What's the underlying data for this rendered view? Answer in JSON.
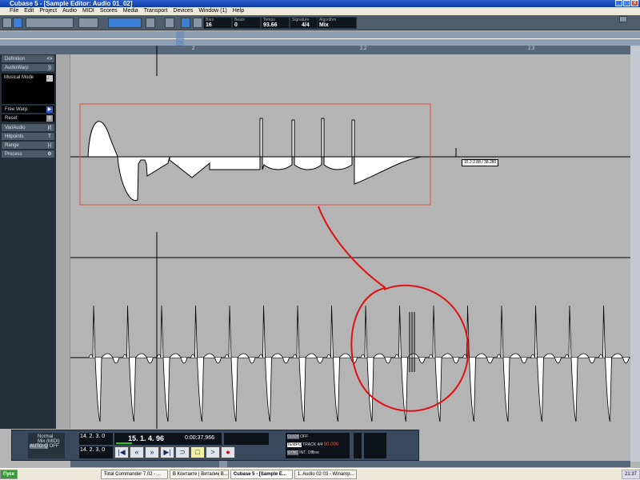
{
  "window": {
    "title": "Cubase 5 - [Sample Editor: Audio 01_02]"
  },
  "menu": [
    "File",
    "Edit",
    "Project",
    "Audio",
    "MIDI",
    "Scores",
    "Media",
    "Transport",
    "Devices",
    "Window (1)",
    "Help"
  ],
  "toolbar": {
    "fields": [
      {
        "label": "Bars",
        "value": "16"
      },
      {
        "label": "Beats",
        "value": "0"
      },
      {
        "label": "Tempo",
        "value": "93.66"
      },
      {
        "label": "Signature",
        "value": "4/4"
      },
      {
        "label": "Algorithm",
        "value": "Mix"
      }
    ]
  },
  "ruler": {
    "marks": [
      "2",
      "2.2",
      "2.3"
    ]
  },
  "sidebar": {
    "sections": [
      {
        "label": "Definition",
        "icon": "<>"
      },
      {
        "label": "AudioWarp",
        "icon": "))"
      },
      {
        "label": "Musical Mode",
        "icon": "♩"
      },
      {
        "label": "Free Warp",
        "icon": "▶"
      },
      {
        "label": "Reset",
        "icon": "≡"
      },
      {
        "label": "VariAudio",
        "icon": "|/|"
      },
      {
        "label": "Hitpoints",
        "icon": "T"
      },
      {
        "label": "Range",
        "icon": "|-|"
      },
      {
        "label": "Process",
        "icon": "⚙"
      }
    ]
  },
  "editor": {
    "tooltip": "15.2.2.88 / 38.280"
  },
  "transport": {
    "mode1": "Normal",
    "mode2": "Mix (MIDI)",
    "auto": "AUTO Q",
    "auto_value": "OFF",
    "left_locator": "14. 2. 3.   0",
    "right_locator": "14. 2. 3.   0",
    "position": "15. 1. 4. 96",
    "time": "0:00:37.966",
    "click": "CLICK",
    "click_value": "OFF",
    "tempo_label": "TEMPO",
    "tempo_mode": "TRACK",
    "signature": "4/4",
    "tempo": "90.000",
    "sync": "SYNC",
    "sync_mode": "INT.",
    "sync_state": "Offline"
  },
  "taskbar": {
    "start": "Пуск",
    "items": [
      "Total Commander 7.02 - ...",
      "В Контакте | Виталик В...",
      "Cubase 5 - [Sample E...",
      "1. Audio 02 03 - Winamp..."
    ],
    "clock": "21:37"
  },
  "accent": {
    "annotation": "#e01010",
    "selection": "#e05040"
  }
}
